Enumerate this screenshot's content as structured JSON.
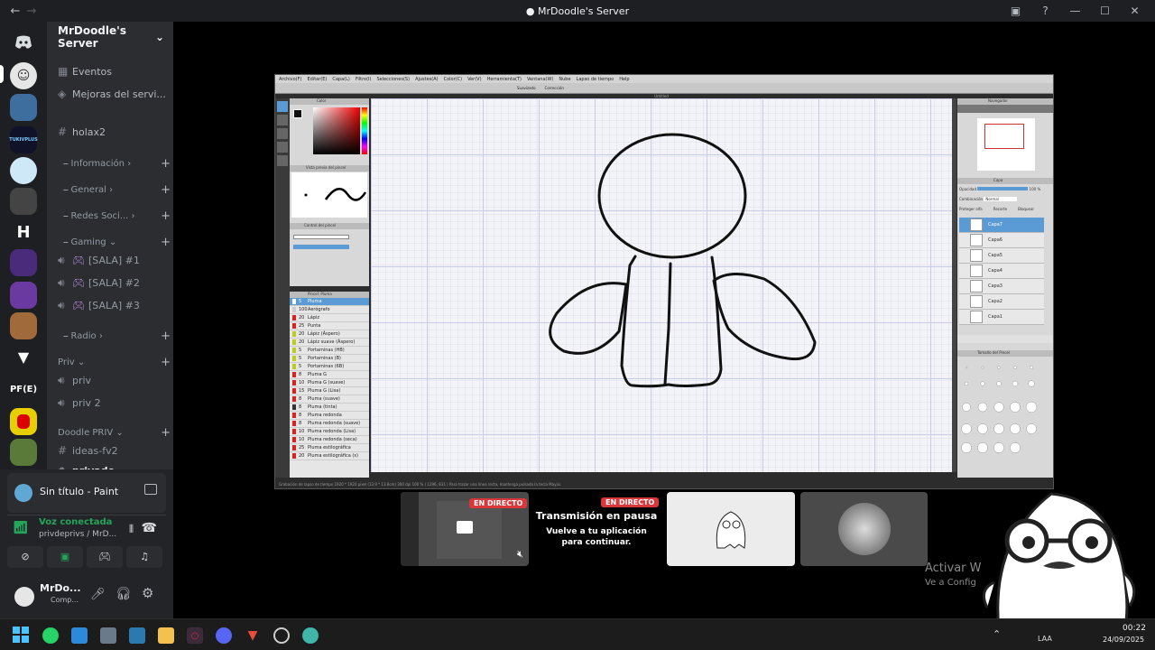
{
  "window": {
    "title": "MrDoodle's Server",
    "back": "←",
    "forward": "→",
    "inbox": "▣",
    "help": "?",
    "minimize": "—",
    "maximize": "☐",
    "close": "✕"
  },
  "server": {
    "name": "MrDoodle's Server",
    "chevron": "⌄"
  },
  "guilds": [
    {
      "label": "TUKIVPLUS"
    },
    {
      "label": "H"
    },
    {
      "label": "PF(E)"
    }
  ],
  "channels": {
    "events": "Eventos",
    "boosts": "Mejoras del servi...",
    "holax2": "holax2",
    "informacion": "Información",
    "general": "General",
    "redes": "Redes Soci...",
    "gaming": "Gaming",
    "sala1": "[SALA] #1",
    "sala2": "[SALA] #2",
    "sala3": "[SALA] #3",
    "radio": "Radio",
    "priv_cat": "Priv",
    "priv": "priv",
    "priv2": "priv 2",
    "doodle_priv": "Doodle PRIV",
    "ideas": "ideas-fv2",
    "privado": "privado"
  },
  "activity": {
    "title": "Sin título - Paint"
  },
  "voice": {
    "status": "Voz conectada",
    "location": "privdeprivs / MrD..."
  },
  "user": {
    "name": "MrDo...",
    "status": "Comp..."
  },
  "paint": {
    "menu": [
      "Archivo(F)",
      "Editar(E)",
      "Capa(L)",
      "Filtro(I)",
      "Selecciones(S)",
      "Ajustes(A)",
      "Color(C)",
      "Ver(V)",
      "Herramienta(T)",
      "Ventana(W)",
      "Nube",
      "Lapso de tiempo",
      "Help"
    ],
    "tool_label": "Suavizado",
    "correction_label": "Corrección",
    "canvas_title": "Untitled",
    "color_panel": "Color",
    "brush_preview": "Vista previa del pincel",
    "brush_control": "Control del pincel",
    "brush_list_title": "Pincel: Pluma",
    "brushes": [
      {
        "size": "5",
        "name": "Pluma",
        "color": "#ffffff"
      },
      {
        "size": "100",
        "name": "Aerógrafo",
        "color": "#cccccc"
      },
      {
        "size": "20",
        "name": "Lápiz",
        "color": "#dd2222"
      },
      {
        "size": "25",
        "name": "Punta",
        "color": "#dd2222"
      },
      {
        "size": "20",
        "name": "Lápiz (Áspero)",
        "color": "#bbcc22"
      },
      {
        "size": "20",
        "name": "Lápiz suave (Áspero)",
        "color": "#bbcc22"
      },
      {
        "size": "5",
        "name": "Portaminas (HB)",
        "color": "#bbcc22"
      },
      {
        "size": "5",
        "name": "Portaminas (B)",
        "color": "#bbcc22"
      },
      {
        "size": "5",
        "name": "Portaminas (6B)",
        "color": "#bbcc22"
      },
      {
        "size": "8",
        "name": "Pluma G",
        "color": "#dd2222"
      },
      {
        "size": "10",
        "name": "Pluma G (suave)",
        "color": "#dd2222"
      },
      {
        "size": "15",
        "name": "Pluma G (Lisa)",
        "color": "#dd2222"
      },
      {
        "size": "8",
        "name": "Pluma (suave)",
        "color": "#dd2222"
      },
      {
        "size": "8",
        "name": "Pluma (tinta)",
        "color": "#333333"
      },
      {
        "size": "8",
        "name": "Pluma redonda",
        "color": "#dd2222"
      },
      {
        "size": "8",
        "name": "Pluma redonda (suave)",
        "color": "#dd2222"
      },
      {
        "size": "10",
        "name": "Pluma redonda (Lisa)",
        "color": "#dd2222"
      },
      {
        "size": "10",
        "name": "Pluma redonda (seca)",
        "color": "#dd2222"
      },
      {
        "size": "25",
        "name": "Pluma estilográfica",
        "color": "#dd2222"
      },
      {
        "size": "20",
        "name": "Pluma estilográfica (s)",
        "color": "#dd2222"
      }
    ],
    "navigator": "Navegador",
    "layer_panel": "Capa",
    "opacity_label": "Opacidad",
    "opacity_value": "100 %",
    "blend_label": "Combinación",
    "blend_value": "Normal",
    "layer_options": [
      "Proteger alfa",
      "Recorte",
      "Bloquear"
    ],
    "layers": [
      "Capa7",
      "Capa6",
      "Capa5",
      "Capa4",
      "Capa3",
      "Capa2",
      "Capa1"
    ],
    "brush_size_panel": "Tamaño del Pincel",
    "status": "Grabación de lapso de tiempo 1920 * 1920 pixel (13.9 * 13.8cm) 300 dpi 100 % ( 1296, 831 ) Para trazar una línea recta, mantenga pulsada la tecla Mayús."
  },
  "stream_tiles": {
    "live_label": "EN DIRECTO",
    "paused_title": "Transmisión en pausa",
    "paused_subtitle": "Vuelve a tu aplicación para continuar."
  },
  "watermark": {
    "line1": "Activar W",
    "line2": "Ve a Config"
  },
  "taskbar": {
    "lang": "LAA",
    "time": "00:22",
    "date": "24/09/2025"
  }
}
